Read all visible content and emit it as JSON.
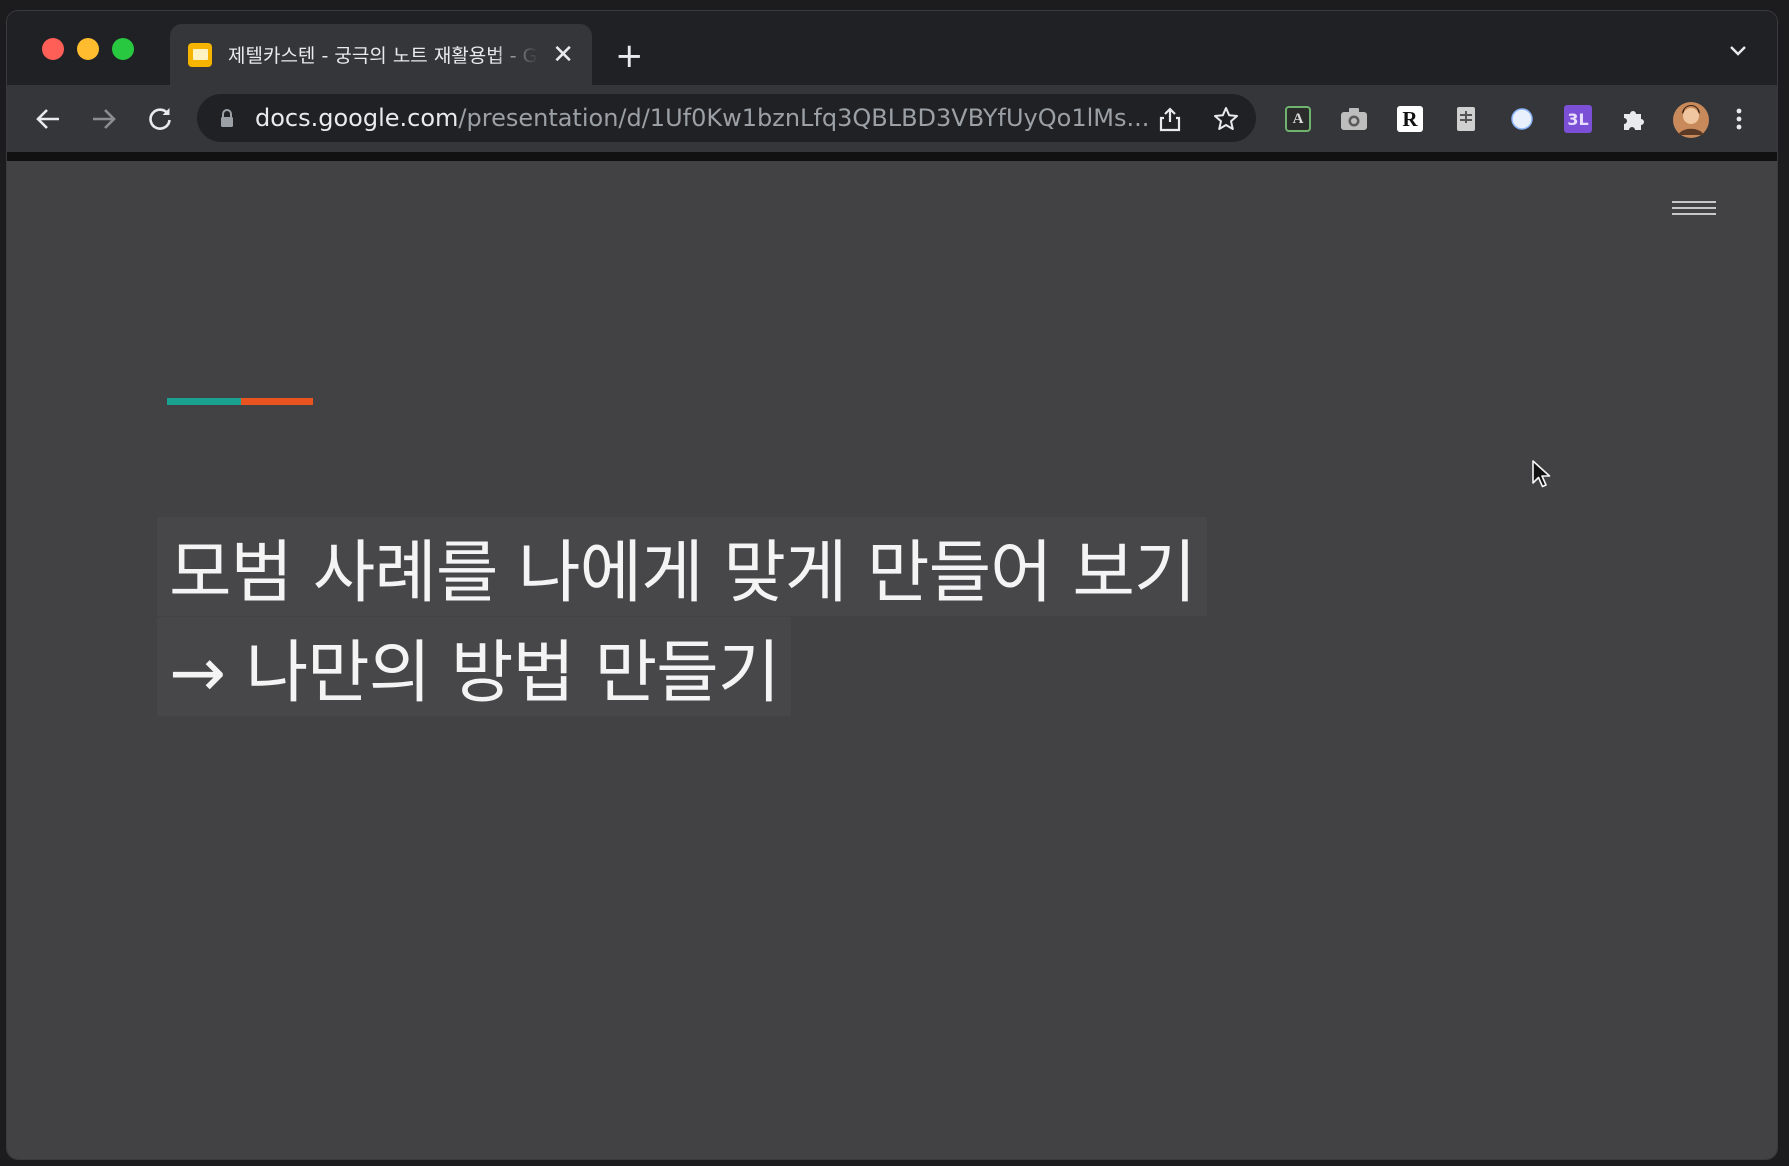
{
  "browser": {
    "tab": {
      "title": "제텔카스텐 - 궁극의 노트 재활용법 - Google Slides",
      "close_glyph": "✕"
    },
    "new_tab_glyph": "+",
    "address": {
      "host": "docs.google.com",
      "path": "/presentation/d/1Uf0Kw1bznLfq3QBLBD3VBYfUyQo1lMs..."
    },
    "extensions": [
      "abbyy-icon",
      "camera-icon",
      "readwise-icon",
      "notes-icon",
      "circle-icon",
      "3l-icon",
      "puzzle-icon",
      "profile-avatar",
      "more-menu-icon"
    ],
    "extension_labels": {
      "abbyy": "A",
      "readwise": "R",
      "three_l": "3L"
    }
  },
  "slide": {
    "line1": "모범 사례를 나에게 맞게 만들어 보기",
    "line2": "→ 나만의 방법 만들기",
    "accent_colors": [
      "#1aa190",
      "#e8531f"
    ],
    "background": "#424244"
  }
}
